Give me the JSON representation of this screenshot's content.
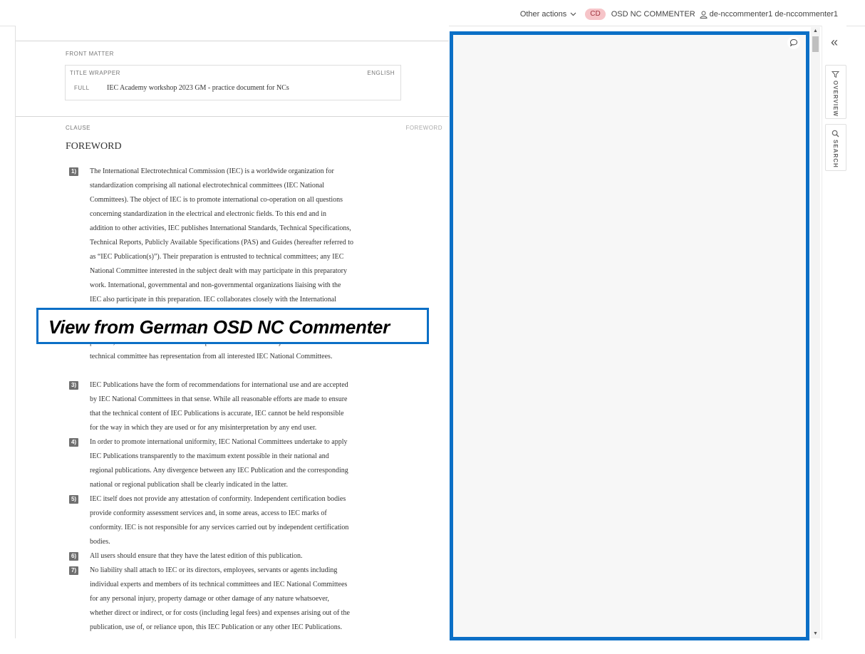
{
  "header": {
    "other_actions": "Other actions",
    "role_badge": "CD",
    "role_label": "OSD NC COMMENTER",
    "username": "de-nccommenter1 de-nccommenter1"
  },
  "document": {
    "front_matter_label": "FRONT MATTER",
    "title_wrapper": {
      "label": "TITLE WRAPPER",
      "language": "ENGLISH",
      "full_label": "FULL",
      "title": "IEC Academy workshop 2023 GM - practice document for NCs"
    },
    "clause_label": "CLAUSE",
    "clause_tag": "FOREWORD",
    "heading": "FOREWORD",
    "items": [
      {
        "num": "1)",
        "lines": [
          "The International Electrotechnical Commission (IEC) is a worldwide organization for",
          "standardization comprising all national electrotechnical committees (IEC National",
          "Committees). The object of IEC is to promote international co-operation on all questions",
          "concerning standardization in the electrical and electronic fields. To this end and in",
          "addition to other activities, IEC publishes International Standards, Technical Specifications,",
          "Technical Reports, Publicly Available Specifications (PAS) and Guides (hereafter referred to",
          "as “IEC Publication(s)”). Their preparation is entrusted to technical committees; any IEC",
          "National Committee interested in the subject dealt with may participate in this preparatory",
          "work. International, governmental and non-governmental organizations liaising with the",
          "IEC also participate in this preparation. IEC collaborates closely with the International"
        ]
      },
      {
        "num": "",
        "lines": [
          "possible, an international consensus of opinion on the relevant subjects since each",
          "technical committee has representation from all interested IEC National Committees."
        ]
      },
      {
        "num": "3)",
        "lines": [
          "IEC Publications have the form of recommendations for international use and are accepted",
          "by IEC National Committees in that sense. While all reasonable efforts are made to ensure",
          "that the technical content of IEC Publications is accurate, IEC cannot be held responsible",
          "for the way in which they are used or for any misinterpretation by any end user."
        ]
      },
      {
        "num": "4)",
        "lines": [
          "In order to promote international uniformity, IEC National Committees undertake to apply",
          "IEC Publications transparently to the maximum extent possible in their national and",
          "regional publications. Any divergence between any IEC Publication and the corresponding",
          "national or regional publication shall be clearly indicated in the latter."
        ]
      },
      {
        "num": "5)",
        "lines": [
          "IEC itself does not provide any attestation of conformity. Independent certification bodies",
          "provide conformity assessment services and, in some areas, access to IEC marks of",
          "conformity. IEC is not responsible for any services carried out by independent certification",
          "bodies."
        ]
      },
      {
        "num": "6)",
        "lines": [
          "All users should ensure that they have the latest edition of this publication."
        ]
      },
      {
        "num": "7)",
        "lines": [
          "No liability shall attach to IEC or its directors, employees, servants or agents including",
          "individual experts and members of its technical committees and IEC National Committees",
          "for any personal injury, property damage or other damage of any nature whatsoever,",
          "whether direct or indirect, or for costs (including legal fees) and expenses arising out of the",
          "publication, use of, or reliance upon, this IEC Publication or any other IEC Publications."
        ]
      }
    ]
  },
  "overlay": {
    "text": "View from German OSD NC Commenter"
  },
  "right_rail": {
    "overview_label": "OVERVIEW",
    "search_label": "SEARCH"
  },
  "icons": {
    "chevron": "chevron-down-icon",
    "user": "user-icon",
    "comment": "comment-bubble-icon",
    "collapse": "double-chevron-left-icon",
    "filter": "filter-icon",
    "search": "search-icon"
  }
}
